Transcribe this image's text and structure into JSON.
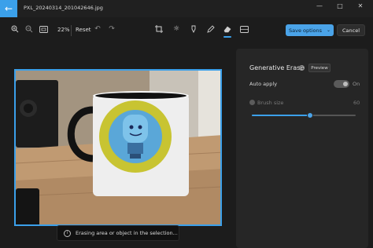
{
  "titlebar": {
    "file_name": "PXL_20240314_201042646.jpg",
    "back_icon": "arrow-left-icon",
    "controls": [
      "minimize-icon",
      "maximize-icon",
      "close-icon"
    ]
  },
  "toolbar": {
    "zoom_level": "22%",
    "reset_label": "Reset",
    "save_label": "Save options",
    "cancel_label": "Cancel",
    "active_tool": "erase",
    "accent_color": "#3ba0ea"
  },
  "panel": {
    "title": "Generative Erase",
    "preview_label": "Preview",
    "auto_apply_label": "Auto apply",
    "auto_apply_state": "On",
    "brush_size_label": "Brush size",
    "brush_size_value": "60"
  },
  "toast": {
    "message": "Erasing area or object in the selection..."
  }
}
